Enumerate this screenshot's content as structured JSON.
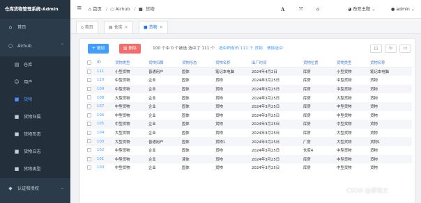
{
  "app": {
    "title": "仓库货物管理系统-Admin"
  },
  "sidebar": {
    "items": [
      {
        "label": "首页",
        "icon": "home-icon"
      },
      {
        "label": "Airhub",
        "icon": "circle-icon"
      },
      {
        "label": "仓库",
        "icon": "warehouse-icon"
      },
      {
        "label": "用户",
        "icon": "user-icon"
      },
      {
        "label": "货物",
        "icon": "truck-icon"
      },
      {
        "label": "货物归属",
        "icon": "truck-icon"
      },
      {
        "label": "货物形态",
        "icon": "truck-icon"
      },
      {
        "label": "货物日志",
        "icon": "truck-icon"
      },
      {
        "label": "货物类型",
        "icon": "truck-icon"
      },
      {
        "label": "认证和授权",
        "icon": "shield-icon"
      }
    ]
  },
  "topbar": {
    "breadcrumb": [
      "首页",
      "Airhub",
      "货物"
    ],
    "theme_label": "改变主题",
    "user_name": "admin"
  },
  "tabs": [
    {
      "label": "首页"
    },
    {
      "label": "仓库"
    },
    {
      "label": "货物"
    }
  ],
  "toolbar": {
    "add_label": "+ 增加",
    "delete_label": "删除",
    "selection_text": "100 个中 0 个被选  选中了 111 个",
    "select_all_link": "选中所有的 111 个 货物",
    "clear_link": "清除选中"
  },
  "table": {
    "columns": [
      "ID",
      "货物类型",
      "货物归属",
      "货物形态",
      "货物名称",
      "出厂时间",
      "货物位置",
      "货物类型",
      "货物名称"
    ],
    "rows": [
      [
        "111",
        "小型货物",
        "普通用户",
        "固体",
        "笔记本电脑",
        "2024年4月2日",
        "库房",
        "小型货物",
        "笔记本电脑"
      ],
      [
        "110",
        "中型货物",
        "企业",
        "固体",
        "货物",
        "2024年3月25日",
        "库房",
        "中型货物",
        "货物"
      ],
      [
        "109",
        "中型货物",
        "企业",
        "固体",
        "货物",
        "2024年3月25日",
        "库房",
        "中型货物",
        "货物"
      ],
      [
        "108",
        "大型货物",
        "企业",
        "固体",
        "货物",
        "2024年3月25日",
        "库房",
        "大型货物",
        "货物"
      ],
      [
        "107",
        "中型货物",
        "企业",
        "固体",
        "货物",
        "2024年3月25日",
        "库房",
        "中型货物",
        "货物"
      ],
      [
        "106",
        "中型货物",
        "企业",
        "固体",
        "货物",
        "2024年3月25日",
        "库房",
        "中型货物",
        "货物"
      ],
      [
        "105",
        "中型货物",
        "企业",
        "固体",
        "货物",
        "2024年3月25日",
        "库房",
        "中型货物",
        "货物"
      ],
      [
        "104",
        "大型货物",
        "企业",
        "固体",
        "货物",
        "2024年3月25日",
        "库房",
        "大型货物",
        "货物"
      ],
      [
        "103",
        "大型货物",
        "普通用户",
        "固体",
        "货物1",
        "2024年3月25日",
        "厂房",
        "大型货物",
        "货物1"
      ],
      [
        "102",
        "中型货物",
        "企业",
        "固体",
        "货物",
        "2024年3月25日",
        "仓库4",
        "中型货物",
        "货物"
      ],
      [
        "101",
        "中型货物",
        "企业",
        "液体",
        "货物",
        "2024年3月25日",
        "库房",
        "中型货物",
        "货物"
      ],
      [
        "100",
        "中型货物",
        "企业",
        "固体",
        "货物",
        "2024年3月25日",
        "库房",
        "中型货物",
        "货物"
      ]
    ]
  },
  "watermark": "CSDN @郑浩文",
  "colors": {
    "sidebar_bg": "#2c3b4a",
    "accent": "#409eff",
    "danger": "#f56c6c"
  }
}
